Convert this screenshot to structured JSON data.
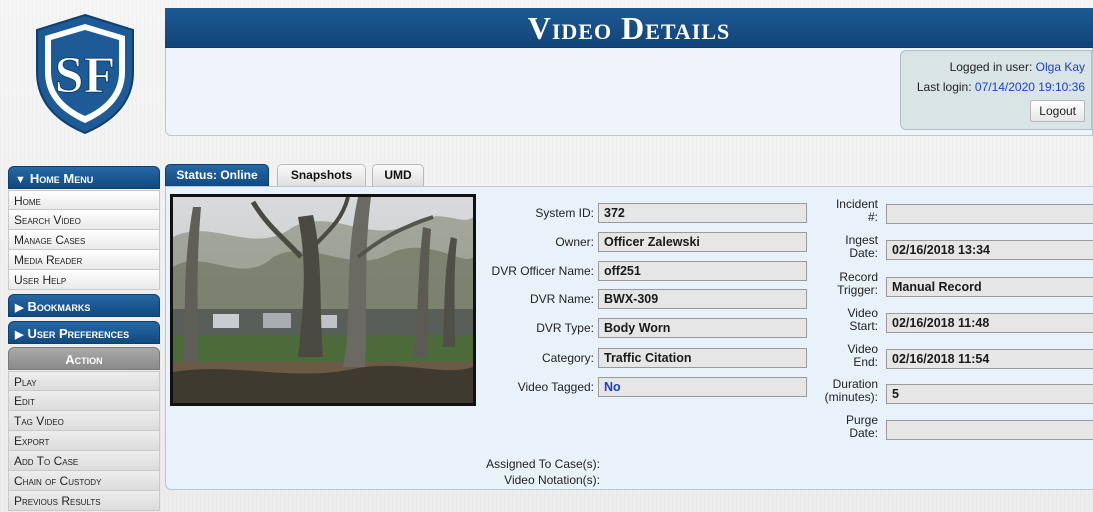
{
  "header": {
    "title": "Video Details",
    "logged_in_label": "Logged in user:",
    "logged_in_user": "Olga Kay",
    "last_login_label": "Last login:",
    "last_login_value": "07/14/2020 19:10:36",
    "logout_label": "Logout"
  },
  "logo": {
    "letters": "SF"
  },
  "sidebar": {
    "home_menu_header": "Home Menu",
    "home_items": [
      "Home",
      "Search Video",
      "Manage Cases",
      "Media Reader",
      "User Help"
    ],
    "bookmarks_header": "Bookmarks",
    "preferences_header": "User Preferences",
    "action_header": "Action",
    "action_items": [
      "Play",
      "Edit",
      "Tag Video",
      "Export",
      "Add To Case",
      "Chain of Custody",
      "Previous Results"
    ]
  },
  "tabs": [
    "Status: Online",
    "Snapshots",
    "UMD"
  ],
  "details": {
    "left_fields": [
      {
        "label": "System ID:",
        "value": "372"
      },
      {
        "label": "Owner:",
        "value": "Officer Zalewski"
      },
      {
        "label": "DVR Officer Name:",
        "value": "off251"
      },
      {
        "label": "DVR Name:",
        "value": "BWX-309"
      },
      {
        "label": "DVR Type:",
        "value": "Body Worn"
      },
      {
        "label": "Category:",
        "value": "Traffic Citation"
      },
      {
        "label": "Video Tagged:",
        "value": "No"
      }
    ],
    "right_fields": [
      {
        "label1": "Incident",
        "label2": "#:",
        "value": ""
      },
      {
        "label1": "Ingest",
        "label2": "Date:",
        "value": "02/16/2018 13:34"
      },
      {
        "label1": "Record",
        "label2": "Trigger:",
        "value": "Manual Record"
      },
      {
        "label1": "Video",
        "label2": "Start:",
        "value": "02/16/2018 11:48"
      },
      {
        "label1": "Video",
        "label2": "End:",
        "value": "02/16/2018 11:54"
      },
      {
        "label1": "Duration",
        "label2": "(minutes):",
        "value": "5"
      },
      {
        "label1": "Purge",
        "label2": "Date:",
        "value": ""
      }
    ],
    "assigned_label": "Assigned To Case(s):",
    "notation_label": "Video Notation(s):"
  },
  "colors": {
    "accent_blue": "#12497f",
    "link_blue": "#1a3fd0",
    "panel_bg": "#e9f2fa"
  }
}
